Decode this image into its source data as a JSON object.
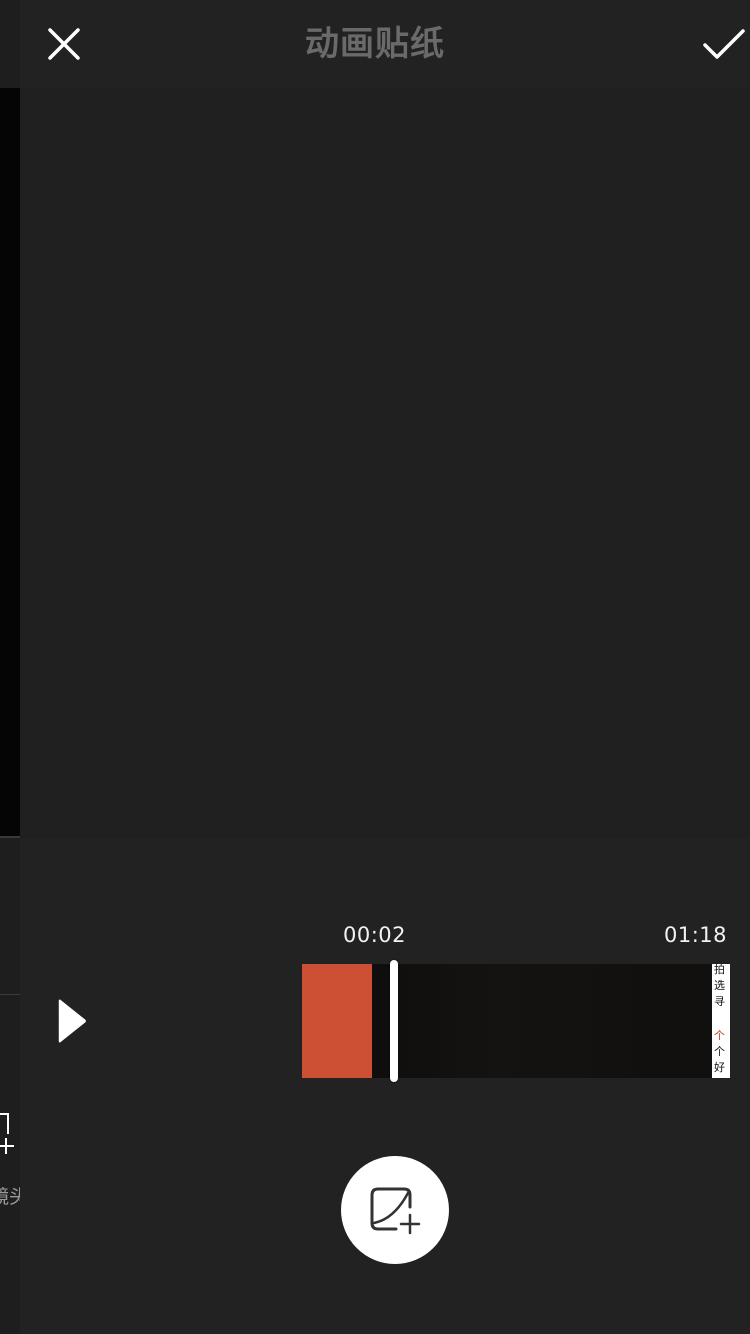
{
  "header": {
    "title": "动画贴纸"
  },
  "timeline": {
    "current_time": "00:02",
    "total_time": "01:18",
    "sticker_clip_color": "#cd5034",
    "thumbnail_lines": [
      "拍",
      "选",
      "寻",
      "",
      "个",
      "个",
      "好"
    ]
  },
  "background_app": {
    "partial_label": "镜头"
  },
  "icons": {
    "close": "close-icon",
    "confirm": "checkmark-icon",
    "play": "play-icon",
    "add_sticker": "add-sticker-icon"
  },
  "colors": {
    "panel_bg": "#202020",
    "topbar_bg": "#222222",
    "title_color": "#6a6a6a",
    "accent": "#cd5034"
  }
}
